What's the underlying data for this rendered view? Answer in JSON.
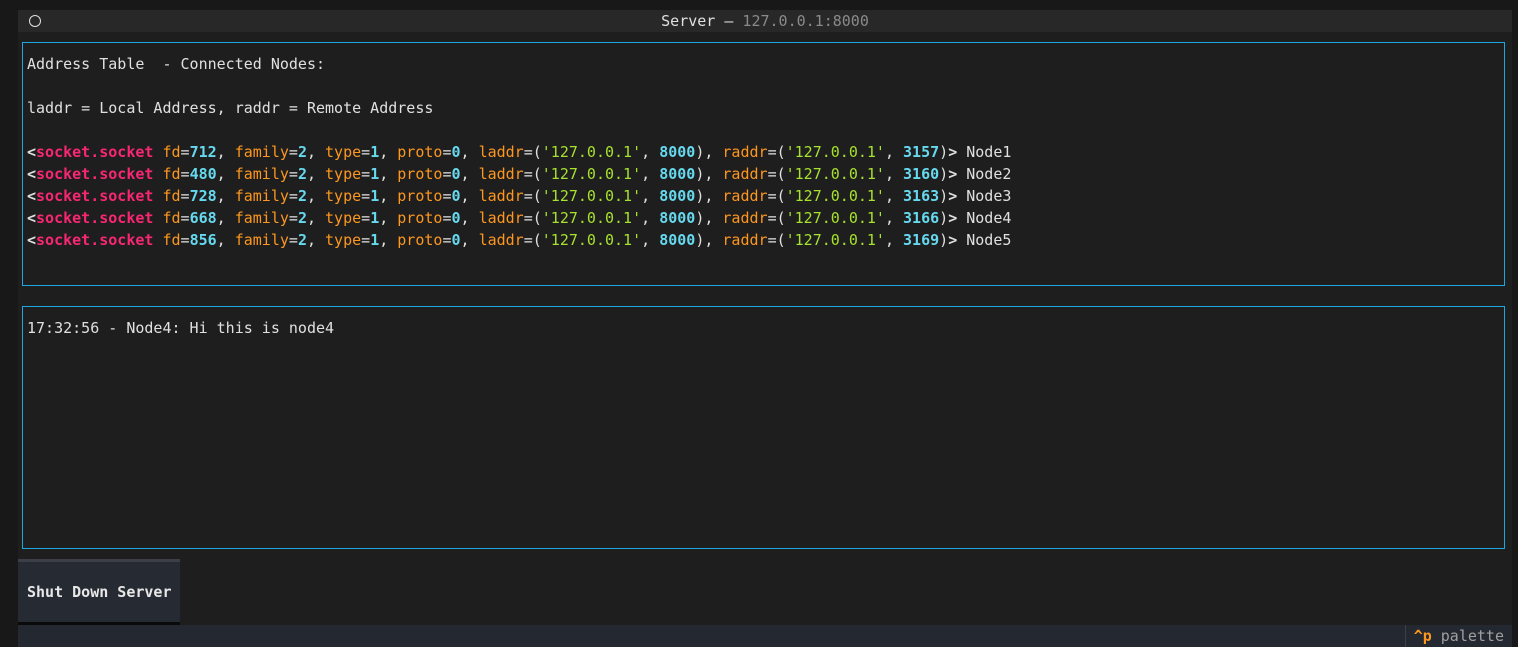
{
  "header": {
    "title": "Server",
    "separator": " — ",
    "subtitle": "127.0.0.1:8000",
    "icon": "circle-icon"
  },
  "address_table": {
    "title": "Address Table  - Connected Nodes:",
    "legend": "laddr = Local Address, raddr = Remote Address",
    "sockets": [
      {
        "fd": "712",
        "family": "2",
        "type": "1",
        "proto": "0",
        "laddr_ip": "'127.0.0.1'",
        "laddr_port": "8000",
        "raddr_ip": "'127.0.0.1'",
        "raddr_port": "3157",
        "node": "Node1"
      },
      {
        "fd": "480",
        "family": "2",
        "type": "1",
        "proto": "0",
        "laddr_ip": "'127.0.0.1'",
        "laddr_port": "8000",
        "raddr_ip": "'127.0.0.1'",
        "raddr_port": "3160",
        "node": "Node2"
      },
      {
        "fd": "728",
        "family": "2",
        "type": "1",
        "proto": "0",
        "laddr_ip": "'127.0.0.1'",
        "laddr_port": "8000",
        "raddr_ip": "'127.0.0.1'",
        "raddr_port": "3163",
        "node": "Node3"
      },
      {
        "fd": "668",
        "family": "2",
        "type": "1",
        "proto": "0",
        "laddr_ip": "'127.0.0.1'",
        "laddr_port": "8000",
        "raddr_ip": "'127.0.0.1'",
        "raddr_port": "3166",
        "node": "Node4"
      },
      {
        "fd": "856",
        "family": "2",
        "type": "1",
        "proto": "0",
        "laddr_ip": "'127.0.0.1'",
        "laddr_port": "8000",
        "raddr_ip": "'127.0.0.1'",
        "raddr_port": "3169",
        "node": "Node5"
      }
    ]
  },
  "messages": [
    "17:32:56 - Node4: Hi this is node4"
  ],
  "shutdown_button": "Shut Down Server",
  "footer": {
    "key": "^p",
    "label": "palette"
  },
  "colors": {
    "keyword": "#fd971f",
    "number": "#66d9ef",
    "string": "#a6e22e",
    "class": "#f92672",
    "border": "#1ba8e0"
  }
}
